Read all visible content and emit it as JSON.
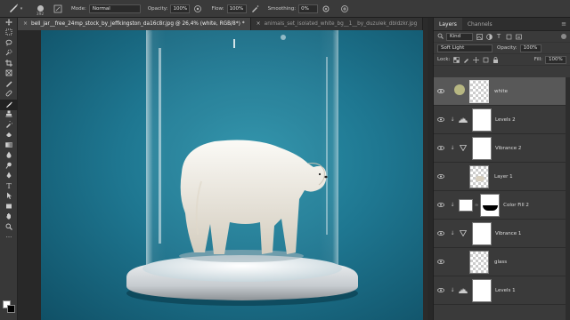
{
  "options": {
    "brush_size": "392",
    "mode_label": "Mode:",
    "mode_value": "Normal",
    "opacity_label": "Opacity:",
    "opacity_value": "100%",
    "flow_label": "Flow:",
    "flow_value": "100%",
    "smoothing_label": "Smoothing:",
    "smoothing_value": "0%"
  },
  "tabs": [
    {
      "label": "bell_jar__free_24mp_stock_by_jeffkingston_da16c8r.jpg @ 26,4% (white, RGB/8*) *",
      "active": true
    },
    {
      "label": "animals_set_isolated_white_bg__1__by_duzulek_dbldzkr.jpg",
      "active": false
    }
  ],
  "panel": {
    "tabs": [
      "Layers",
      "Channels"
    ],
    "filter_kind": "Kind",
    "blend_mode": "Soft Light",
    "opacity_label": "Opacity:",
    "opacity_value": "100%",
    "lock_label": "Lock:",
    "fill_label": "Fill:",
    "fill_value": "100%"
  },
  "layers": [
    {
      "name": "white",
      "selected": true
    },
    {
      "name": "Levels 2",
      "type": "levels"
    },
    {
      "name": "Vibrance 2",
      "type": "vibrance"
    },
    {
      "name": "Layer 1",
      "type": "layer"
    },
    {
      "name": "Color Fill 2",
      "type": "colorfill"
    },
    {
      "name": "Vibrance 1",
      "type": "vibrance"
    },
    {
      "name": "glass",
      "type": "layer"
    },
    {
      "name": "Levels 1",
      "type": "levels"
    }
  ],
  "colors": {
    "canvas_bg": "#1e7690",
    "accent": "#4a90e2"
  }
}
